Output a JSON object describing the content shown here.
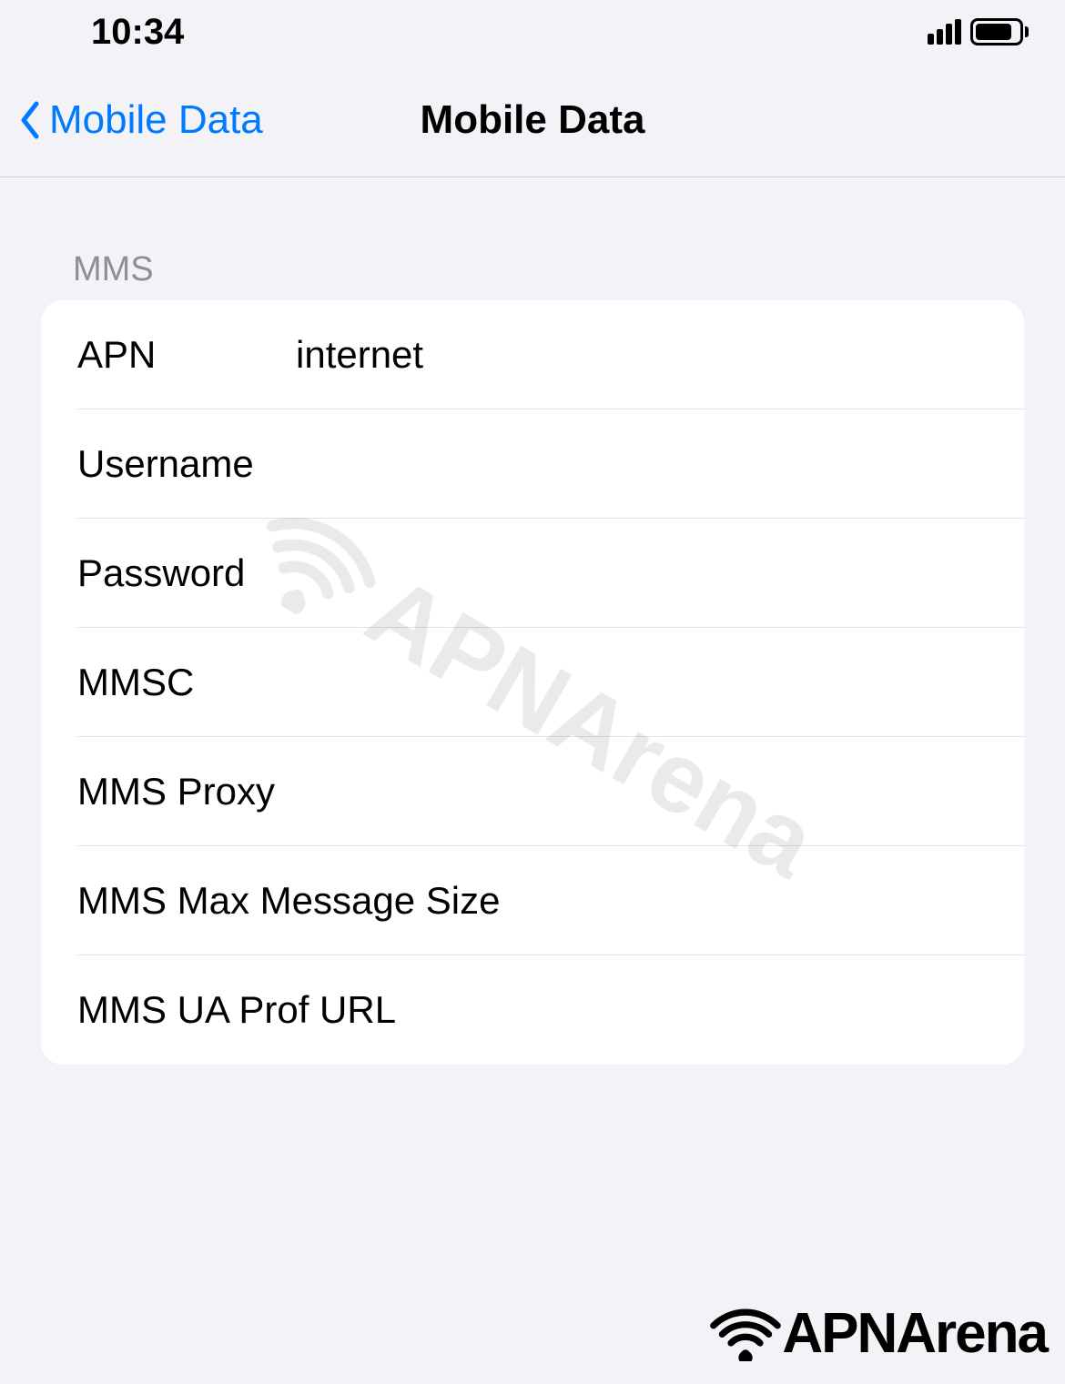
{
  "status_bar": {
    "time": "10:34"
  },
  "nav": {
    "back_label": "Mobile Data",
    "title": "Mobile Data"
  },
  "section": {
    "header": "MMS"
  },
  "fields": {
    "apn": {
      "label": "APN",
      "value": "internet"
    },
    "username": {
      "label": "Username",
      "value": ""
    },
    "password": {
      "label": "Password",
      "value": ""
    },
    "mmsc": {
      "label": "MMSC",
      "value": ""
    },
    "mms_proxy": {
      "label": "MMS Proxy",
      "value": ""
    },
    "mms_max_size": {
      "label": "MMS Max Message Size",
      "value": ""
    },
    "mms_ua_prof": {
      "label": "MMS UA Prof URL",
      "value": ""
    }
  },
  "watermark": {
    "text": "APNArena"
  },
  "footer": {
    "text": "APNArena"
  }
}
